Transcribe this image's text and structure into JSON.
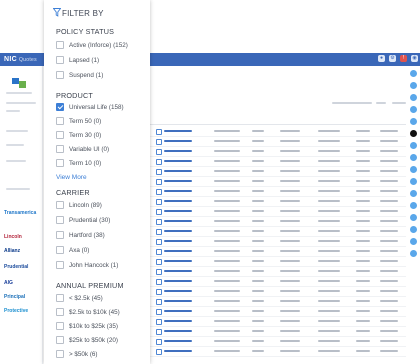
{
  "app": {
    "brand": "NIC",
    "brand_sub": "Quotes"
  },
  "filter": {
    "title": "FILTER BY",
    "policy_status": {
      "title": "POLICY STATUS",
      "options": [
        {
          "label": "Active (Inforce) (152)",
          "checked": false
        },
        {
          "label": "Lapsed (1)",
          "checked": false
        },
        {
          "label": "Suspend (1)",
          "checked": false
        }
      ]
    },
    "product": {
      "title": "PRODUCT",
      "options": [
        {
          "label": "Universal Life (158)",
          "checked": true
        },
        {
          "label": "Term 50 (0)",
          "checked": false
        },
        {
          "label": "Term 30 (0)",
          "checked": false
        },
        {
          "label": "Variable UI (0)",
          "checked": false
        },
        {
          "label": "Term 10 (0)",
          "checked": false
        }
      ],
      "view_more": "View More"
    },
    "carrier": {
      "title": "CARRIER",
      "options": [
        {
          "label": "Lincoln (89)",
          "checked": false
        },
        {
          "label": "Prudential (30)",
          "checked": false
        },
        {
          "label": "Hartford (38)",
          "checked": false
        },
        {
          "label": "Axa (0)",
          "checked": false
        },
        {
          "label": "John Hancock (1)",
          "checked": false
        }
      ]
    },
    "annual_premium": {
      "title": "ANNUAL PREMIUM",
      "options": [
        {
          "label": "< $2.5k (45)",
          "checked": false
        },
        {
          "label": "$2.5k to $10k (45)",
          "checked": false
        },
        {
          "label": "$10k to $25k (35)",
          "checked": false
        },
        {
          "label": "$25k to $50k (20)",
          "checked": false
        },
        {
          "label": "> $50k (6)",
          "checked": false
        }
      ]
    }
  },
  "nav": {
    "carriers": [
      "Transamerica",
      "Lincoln",
      "Allianz",
      "Prudential",
      "AIG",
      "Principal",
      "Protective"
    ]
  },
  "colors": {
    "accent": "#3a67b8",
    "checkbox_checked": "#3d7fd6",
    "rail_dot": "#5aa7ea"
  }
}
